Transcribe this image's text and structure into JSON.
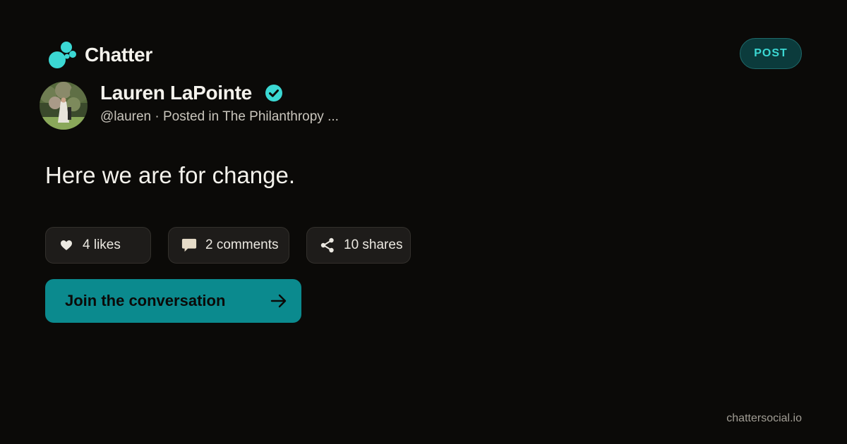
{
  "brand": {
    "name": "Chatter",
    "accent": "#3bd8d3",
    "logo_icon": "bubbles-logo-icon"
  },
  "badge": {
    "label": "POST"
  },
  "author": {
    "name": "Lauren LaPointe",
    "verified": true,
    "verified_icon": "verified-check-icon",
    "meta": "@lauren · Posted in The Philanthropy ..."
  },
  "post": {
    "text": "Here we are for change."
  },
  "stats": {
    "likes": {
      "label": "4 likes",
      "icon": "heart-icon"
    },
    "comments": {
      "label": "2 comments",
      "icon": "comment-bubble-icon"
    },
    "shares": {
      "label": "10 shares",
      "icon": "share-icon"
    }
  },
  "cta": {
    "label": "Join the conversation",
    "icon": "arrow-right-icon"
  },
  "footer": {
    "url": "chattersocial.io"
  },
  "colors": {
    "background": "#0b0a08",
    "cta_background": "#0b8a8e",
    "badge_background": "#0b3b3c"
  }
}
